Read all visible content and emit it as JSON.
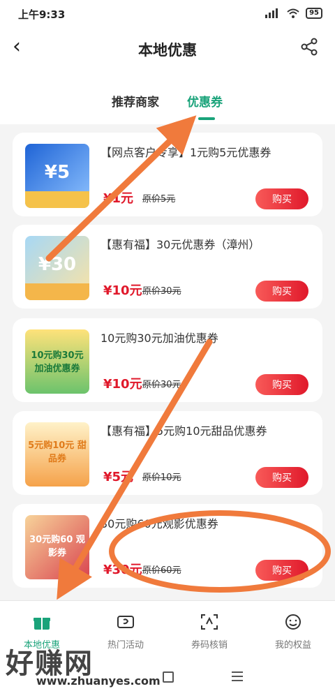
{
  "status": {
    "time": "上午9:33",
    "battery": "95"
  },
  "header": {
    "title": "本地优惠"
  },
  "tabs": [
    {
      "label": "推荐商家"
    },
    {
      "label": "优惠券"
    }
  ],
  "coupons": [
    {
      "title": "【网点客户专享】1元购5元优惠券",
      "price": "¥1元",
      "original": "原价5元",
      "buy_label": "购买",
      "thumb_label": "¥5"
    },
    {
      "title": "【惠有福】30元优惠券（漳州）",
      "price": "¥10元",
      "original": "原价30元",
      "buy_label": "购买",
      "thumb_label": "¥30"
    },
    {
      "title": "10元购30元加油优惠券",
      "price": "¥10元",
      "original": "原价30元",
      "buy_label": "购买",
      "thumb_label": "10元购30元 加油优惠券"
    },
    {
      "title": "【惠有福】5元购10元甜品优惠券",
      "price": "¥5元",
      "original": "原价10元",
      "buy_label": "购买",
      "thumb_label": "5元购10元 甜品券"
    },
    {
      "title": "30元购60元观影优惠券",
      "price": "¥30元",
      "original": "原价60元",
      "buy_label": "购买",
      "thumb_label": "30元购60 观影券"
    }
  ],
  "nav": [
    {
      "label": "本地优惠",
      "icon": "gift-icon"
    },
    {
      "label": "热门活动",
      "icon": "ticket-icon"
    },
    {
      "label": "券码核销",
      "icon": "scan-icon"
    },
    {
      "label": "我的权益",
      "icon": "smile-icon"
    }
  ],
  "watermark": {
    "text": "好赚网",
    "url": "www.zhuanyes.com"
  },
  "colors": {
    "accent": "#1aa37a",
    "price": "#e0192b",
    "annotation": "#f07a3c"
  }
}
